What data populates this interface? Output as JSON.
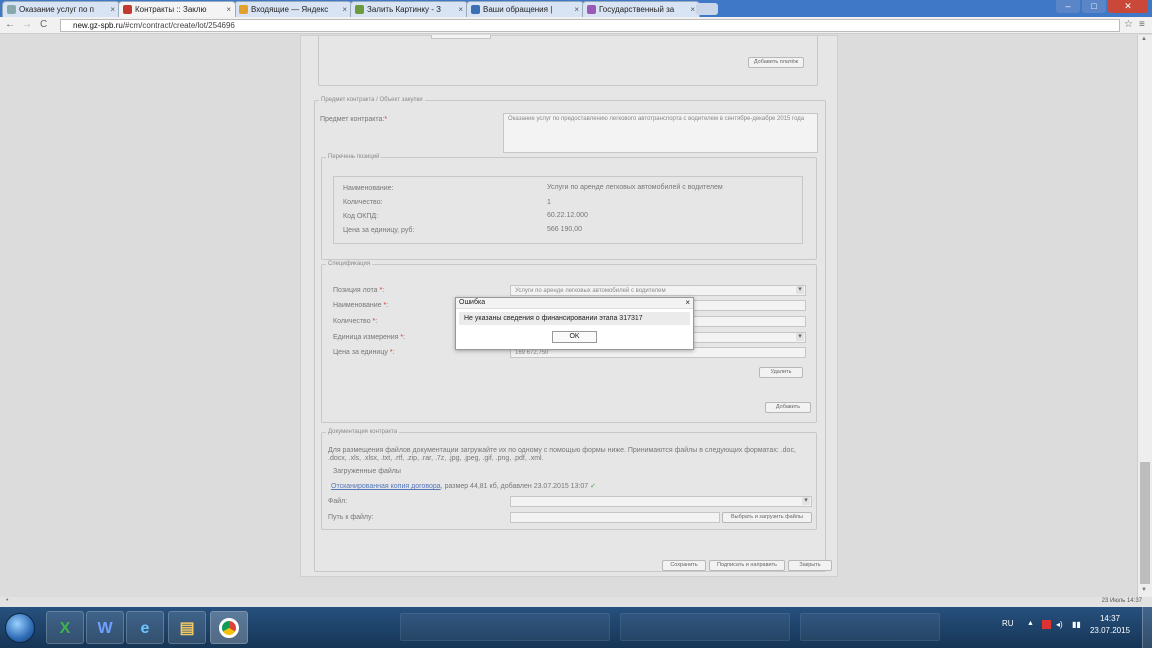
{
  "browser": {
    "tabs": [
      {
        "title": "Оказание услуг по п",
        "fav": "#7b9cc8"
      },
      {
        "title": "Контракты :: Заклю",
        "fav": "#c23b2e"
      },
      {
        "title": "Входящие — Яндекс",
        "fav": "#e2a12a"
      },
      {
        "title": "Залить Картинку - З",
        "fav": "#6c9a3d"
      },
      {
        "title": "Ваши обращения |",
        "fav": "#3a6fb5"
      },
      {
        "title": "Государственный за",
        "fav": "#9b59b6"
      }
    ],
    "url_host": "new.gz-spb.ru",
    "url_path": "/#cm/contract/create/lot/254696"
  },
  "top": {
    "add_payment_button": "Добавить платёж"
  },
  "subject_section": {
    "legend": "Предмет контракта / Объект закупки",
    "subject_label": "Предмет контракта:",
    "subject_value": "Оказание услуг по предоставлению легкового автотранспорта с водителем в сентябре-декабре 2015 года"
  },
  "positions": {
    "legend": "Перечень позиций",
    "rows": [
      {
        "label": "Наименование:",
        "value": "Услуги по аренде легковых автомобилей с водителем"
      },
      {
        "label": "Количество:",
        "value": "1"
      },
      {
        "label": "Код ОКПД:",
        "value": "60.22.12.000"
      },
      {
        "label": "Цена за единицу, руб:",
        "value": "566 190,00"
      }
    ]
  },
  "spec": {
    "legend": "Спецификация",
    "lot_position_label": "Позиция лота",
    "lot_position_value": "Услуги по аренде легковых автомобилей с водителем",
    "name_label": "Наименование",
    "quantity_label": "Количество",
    "unit_label": "Единица измерения",
    "price_label": "Цена за единицу",
    "price_value": "169 672,750",
    "delete_button": "Удалить",
    "add_button": "Добавить"
  },
  "docs": {
    "legend": "Документация контракта",
    "help_text": "Для размещения файлов документации загружайте их по одному с помощью формы ниже. Принимаются файлы в следующих форматах: .doc, .docx, .xls, .xlsx, .txt, .rtf, .zip, .rar, .7z, .jpg, .jpeg, .gif, .png, .pdf, .xml.",
    "uploaded_heading": "Загруженные файлы",
    "file_link": "Отсканированная копия договора",
    "file_info": ", размер 44,81 кб, добавлен 23.07.2015 13:07",
    "file_label": "Файл:",
    "path_label": "Путь к файлу:",
    "upload_button": "Выбрать и загрузить файлы"
  },
  "footer_buttons": {
    "save": "Сохранить",
    "sign_send": "Подписать и направить",
    "close": "Закрыть"
  },
  "dialog": {
    "title": "Ошибка",
    "message": "Не указаны сведения о финансировании этапа 317317",
    "ok": "OK"
  },
  "statusbar": {
    "right_text": "23 Июль 14:37"
  },
  "taskbar": {
    "items": [
      "Excel",
      "Word",
      "Internet Explorer",
      "Explorer",
      "Chrome"
    ],
    "lang": "RU",
    "time": "14:37",
    "date": "23.07.2015"
  }
}
